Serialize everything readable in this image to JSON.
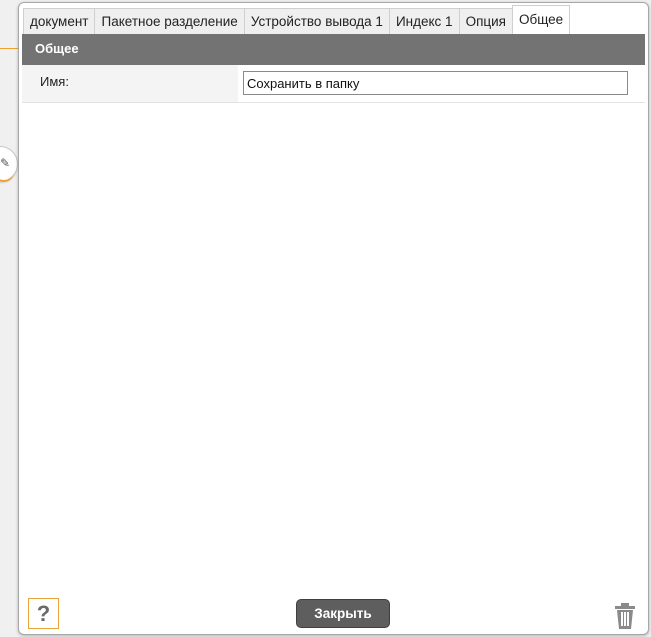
{
  "tabs": [
    {
      "label": "документ"
    },
    {
      "label": "Пакетное разделение"
    },
    {
      "label": "Устройство вывода 1"
    },
    {
      "label": "Индекс 1"
    },
    {
      "label": "Опция"
    },
    {
      "label": "Общее",
      "active": true
    }
  ],
  "section": {
    "title": "Общее"
  },
  "fields": {
    "name_label": "Имя:",
    "name_value": "Сохранить в папку"
  },
  "footer": {
    "help_glyph": "?",
    "close_label": "Закрыть",
    "help_icon": "question-icon",
    "delete_icon": "trash-icon"
  },
  "colors": {
    "header_bg": "#737373",
    "accent": "#e8a33a",
    "close_button_bg": "#5e5e5e"
  }
}
